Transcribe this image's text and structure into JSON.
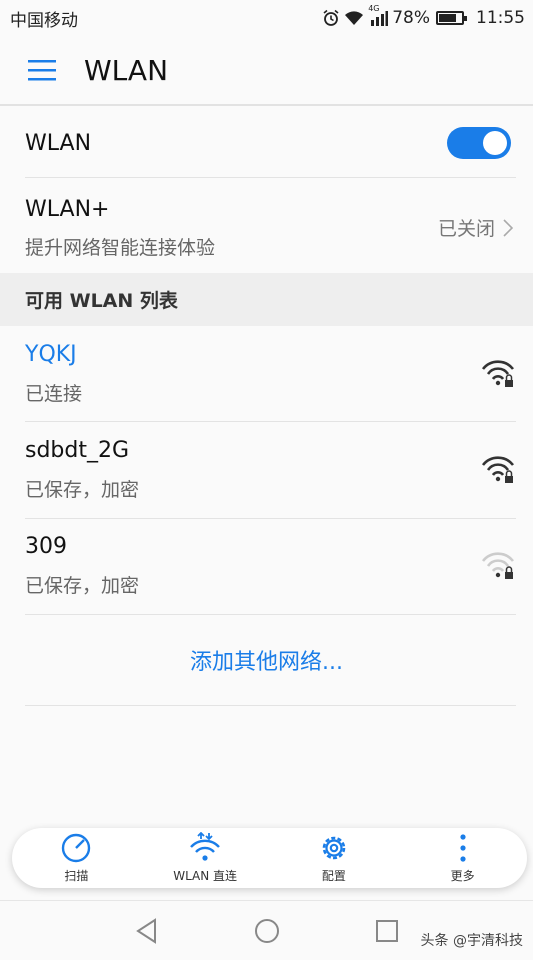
{
  "status_bar": {
    "carrier": "中国移动",
    "network_type": "4G",
    "battery_text": "78%",
    "battery_level": 0.78,
    "time": "11:55",
    "icons": [
      "alarm-icon",
      "wifi-icon",
      "signal-icon",
      "battery-icon"
    ]
  },
  "app_bar": {
    "menu_icon": "menu-icon",
    "title": "WLAN"
  },
  "wlan_toggle": {
    "label": "WLAN",
    "state": "on"
  },
  "wlan_plus": {
    "title": "WLAN+",
    "subtitle": "提升网络智能连接体验",
    "status": "已关闭"
  },
  "available_list": {
    "header": "可用 WLAN 列表",
    "networks": [
      {
        "name": "YQKJ",
        "state": "已连接",
        "connected": true,
        "signal": "strong",
        "locked": true
      },
      {
        "name": "sdbdt_2G",
        "state": "已保存，加密",
        "connected": false,
        "signal": "strong",
        "locked": true
      },
      {
        "name": "309",
        "state": "已保存，加密",
        "connected": false,
        "signal": "weak",
        "locked": true
      }
    ],
    "add_network": "添加其他网络..."
  },
  "bottom_actions": [
    {
      "label": "扫描",
      "icon": "scan-icon"
    },
    {
      "label": "WLAN 直连",
      "icon": "wifi-direct-icon"
    },
    {
      "label": "配置",
      "icon": "settings-gear-icon"
    },
    {
      "label": "更多",
      "icon": "more-vertical-icon"
    }
  ],
  "nav_bar": {
    "icons": [
      "back-icon",
      "home-icon",
      "recents-icon"
    ]
  },
  "watermark": "头条 @宇清科技",
  "colors": {
    "accent": "#1a7de8",
    "background": "#fafafa",
    "section_bg": "#eeeeee"
  }
}
